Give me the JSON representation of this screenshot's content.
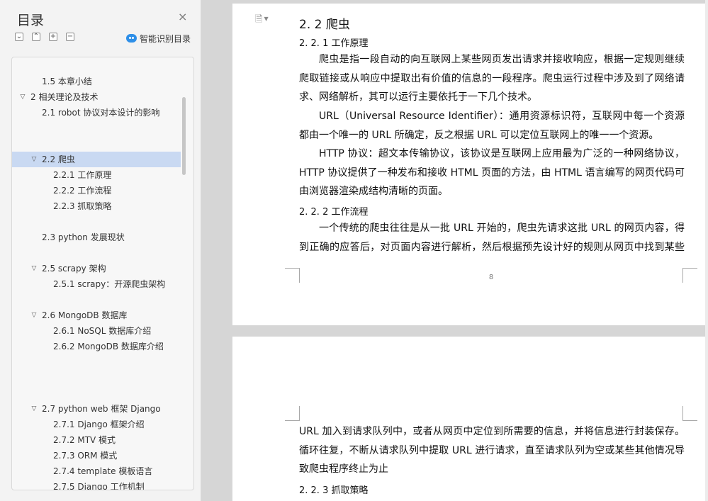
{
  "sidebar": {
    "title": "目录",
    "close_glyph": "×",
    "toolbar": [
      {
        "icon": "collapse-all-icon",
        "glyph": "⌄"
      },
      {
        "icon": "expand-all-icon",
        "glyph": "⌃"
      },
      {
        "icon": "add-level-icon",
        "glyph": "+"
      },
      {
        "icon": "remove-level-icon",
        "glyph": "−"
      }
    ],
    "smart_toc_label": "智能识别目录",
    "smart_toc_icon": "smart-toc-icon",
    "toc": [
      {
        "text": "1.5  本章小结",
        "arrow": ""
      },
      {
        "text": "2  相关理论及技术",
        "arrow": "expanded"
      },
      {
        "text": "2.1 robot 协议对本设计的影响",
        "arrow": ""
      },
      {
        "text": "2.2  爬虫",
        "arrow": "expanded",
        "selected": true
      },
      {
        "text": "2.2.1  工作原理",
        "arrow": ""
      },
      {
        "text": "2.2.2  工作流程",
        "arrow": ""
      },
      {
        "text": "2.2.3  抓取策略",
        "arrow": ""
      },
      {
        "text": "2.3 python 发展现状",
        "arrow": ""
      },
      {
        "text": "2.5 scrapy 架构",
        "arrow": "expanded"
      },
      {
        "text": "2.5.1 scrapy：开源爬虫架构",
        "arrow": ""
      },
      {
        "text": "2.6 MongoDB 数据库",
        "arrow": "expanded"
      },
      {
        "text": "2.6.1 NoSQL 数据库介绍",
        "arrow": ""
      },
      {
        "text": "2.6.2 MongoDB 数据库介绍",
        "arrow": ""
      },
      {
        "text": "2.7 python web 框架 Django",
        "arrow": "expanded"
      },
      {
        "text": "2.7.1 Django 框架介绍",
        "arrow": ""
      },
      {
        "text": "2.7.2 MTV 模式",
        "arrow": ""
      },
      {
        "text": "2.7.3 ORM 模式",
        "arrow": ""
      },
      {
        "text": "2.7.4 template 模板语言",
        "arrow": ""
      },
      {
        "text": "2.7.5 Django 工作机制",
        "arrow": ""
      }
    ]
  },
  "document": {
    "menu_icon": "document-icon",
    "page1": {
      "heading": "2. 2  爬虫",
      "sub1": "2. 2. 1  工作原理",
      "p1": "爬虫是指一段自动的向互联网上某些网页发出请求并接收响应，根据一定规则继续爬取链接或从响应中提取出有价值的信息的一段程序。爬虫运行过程中涉及到了网络请求、网络解析，其可以运行主要依托于一下几个技术。",
      "p2": "URL（Universal Resource Identifier）：通用资源标识符，互联网中每一个资源都由一个唯一的 URL 所确定，反之根据 URL 可以定位互联网上的唯一一个资源。",
      "p3": "HTTP 协议：超文本传输协议，该协议是互联网上应用最为广泛的一种网络协议，HTTP 协议提供了一种发布和接收 HTML 页面的方法，由 HTML 语言编写的网页代码可由浏览器渲染成结构清晰的页面。",
      "sub2": "2. 2. 2  工作流程",
      "p4": "一个传统的爬虫往往是从一批 URL 开始的，爬虫先请求这批 URL 的网页内容，得到正确的应答后，对页面内容进行解析，然后根据预先设计好的规则从网页中找到某些",
      "page_number": "8"
    },
    "page2": {
      "p1": "URL 加入到请求队列中，或者从网页中定位到所需要的信息，并将信息进行封装保存。循环往复，不断从请求队列中提取 URL 进行请求，直至请求队列为空或某些其他情况导致爬虫程序终止为止",
      "sub3": "2. 2. 3  抓取策略"
    }
  }
}
